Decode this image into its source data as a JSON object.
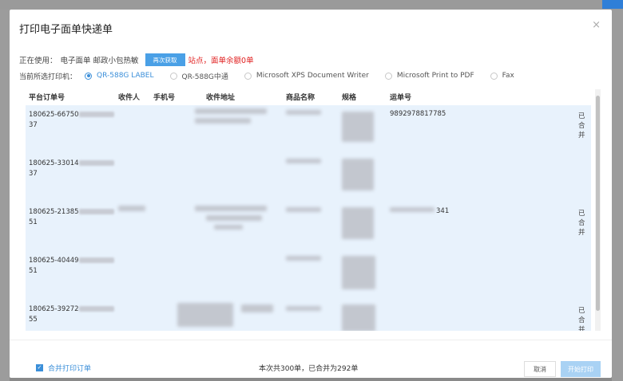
{
  "modal": {
    "title": "打印电子面单快递单",
    "close": "×"
  },
  "using": {
    "label": "正在使用：",
    "value": "电子面单 邮政小包热敏",
    "refetch_button": "再次获取",
    "warning": "站点，面单余额0单"
  },
  "printer": {
    "label": "当前所选打印机：",
    "options": [
      {
        "label": "QR-588G LABEL",
        "selected": true
      },
      {
        "label": "QR-588G中通",
        "selected": false
      },
      {
        "label": "Microsoft XPS Document Writer",
        "selected": false
      },
      {
        "label": "Microsoft Print to PDF",
        "selected": false
      },
      {
        "label": "Fax",
        "selected": false
      }
    ]
  },
  "table": {
    "headers": [
      "平台订单号",
      "收件人",
      "手机号",
      "收件地址",
      "商品名称",
      "规格",
      "运单号"
    ],
    "rows": [
      {
        "order_prefix": "180625-66750",
        "order_suffix": "37",
        "tracking": "9892978817785",
        "merged": "已合并"
      },
      {
        "order_prefix": "180625-33014",
        "order_suffix": "37",
        "tracking": "",
        "merged": ""
      },
      {
        "order_prefix": "180625-21385",
        "order_suffix": "51",
        "tracking": "341",
        "merged": "已合并"
      },
      {
        "order_prefix": "180625-40449",
        "order_suffix": "51",
        "tracking": "",
        "merged": ""
      },
      {
        "order_prefix": "180625-39272",
        "order_suffix": "55",
        "tracking": "",
        "merged": "已合并"
      }
    ]
  },
  "footer": {
    "merge_checkbox": "合并打印订单",
    "summary": "本次共300单，已合并为292单",
    "cancel": "取消",
    "start": "开始打印"
  }
}
